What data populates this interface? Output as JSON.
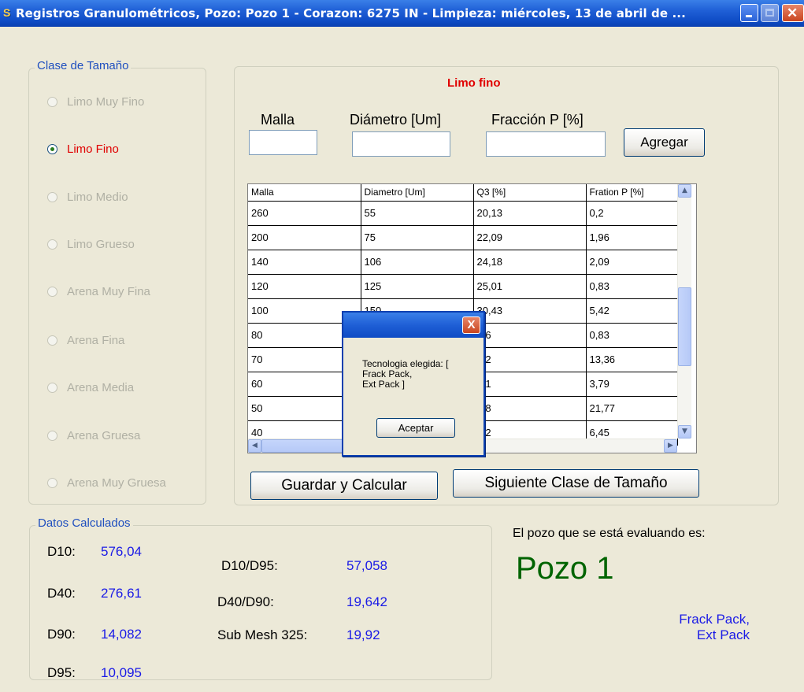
{
  "window": {
    "title": "Registros Granulométricos, Pozo: Pozo 1 - Corazon: 6275 IN  - Limpieza: miércoles, 13 de abril de ...",
    "logo_text": "S",
    "colors": {
      "titlebar": "#1f5fd6",
      "accent_red": "#e00000",
      "value_blue": "#1a1ae6",
      "well_green": "#006400"
    }
  },
  "size_class": {
    "legend": "Clase de Tamaño",
    "selected": "Limo Fino",
    "options": [
      {
        "label": "Limo Muy Fino"
      },
      {
        "label": "Limo Fino"
      },
      {
        "label": "Limo Medio"
      },
      {
        "label": "Limo Grueso"
      },
      {
        "label": "Arena Muy Fina"
      },
      {
        "label": "Arena Fina"
      },
      {
        "label": "Arena Media"
      },
      {
        "label": "Arena Gruesa"
      },
      {
        "label": "Arena Muy Gruesa"
      }
    ]
  },
  "entry": {
    "title": "Limo fino",
    "malla_label": "Malla",
    "diametro_label": "Diámetro [Um]",
    "fraccion_label": "Fracción P [%]",
    "malla_value": "",
    "diametro_value": "",
    "fraccion_value": "",
    "add_button": "Agregar"
  },
  "grid": {
    "columns": [
      "Malla",
      "Diametro [Um]",
      "Q3 [%]",
      "Fration P [%]"
    ],
    "rows": [
      [
        "260",
        "55",
        "20,13",
        "0,2"
      ],
      [
        "200",
        "75",
        "22,09",
        "1,96"
      ],
      [
        "140",
        "106",
        "24,18",
        "2,09"
      ],
      [
        "120",
        "125",
        "25,01",
        "0,83"
      ],
      [
        "100",
        "150",
        "30,43",
        "5,42"
      ],
      [
        "80",
        "",
        ",26",
        "0,83"
      ],
      [
        "70",
        "",
        ",62",
        "13,36"
      ],
      [
        "60",
        "",
        ",41",
        "3,79"
      ],
      [
        "50",
        "",
        ",18",
        "21,77"
      ],
      [
        "40",
        "",
        ",62",
        "6,45"
      ]
    ]
  },
  "actions": {
    "save_button": "Guardar y Calcular",
    "next_button": "Siguiente Clase de Tamaño"
  },
  "dialog": {
    "message": "Tecnologia elegida: [\nFrack Pack,\nExt Pack ]",
    "ok_button": "Aceptar",
    "close_glyph": "X"
  },
  "calculated": {
    "legend": "Datos Calculados",
    "d10_label": "D10:",
    "d10": "576,04",
    "d40_label": "D40:",
    "d40": "276,61",
    "d90_label": "D90:",
    "d90": "14,082",
    "d95_label": "D95:",
    "d95": "10,095",
    "d10_d95_label": "D10/D95:",
    "d10_d95": "57,058",
    "d40_d90_label": "D40/D90:",
    "d40_d90": "19,642",
    "submesh_label": "Sub Mesh 325:",
    "submesh": "19,92"
  },
  "well": {
    "caption": "El pozo que se está evaluando es:",
    "name": "Pozo 1",
    "technology": "Frack Pack,\nExt Pack"
  }
}
